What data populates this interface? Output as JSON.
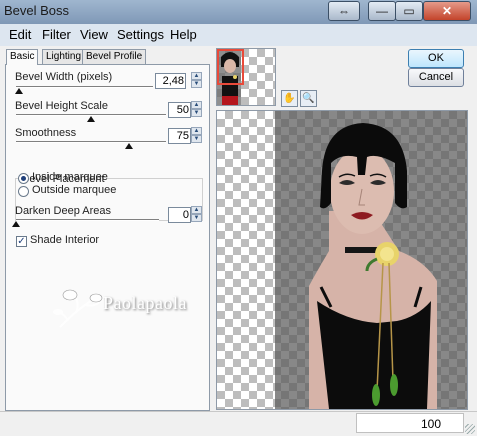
{
  "window": {
    "title": "Bevel Boss",
    "buttons": {
      "restore": "⇔",
      "minimize": "—",
      "maximize": "▭",
      "close": "✕"
    }
  },
  "menu": [
    "Edit",
    "Filter",
    "View",
    "Settings",
    "Help"
  ],
  "tabs": [
    "Basic",
    "Lighting",
    "Bevel Profile"
  ],
  "basic": {
    "bevel_width": {
      "label": "Bevel Width (pixels)",
      "value": "2,48",
      "level": 0.02
    },
    "bevel_height": {
      "label": "Bevel Height Scale",
      "value": "50",
      "level": 0.5
    },
    "smoothness": {
      "label": "Smoothness",
      "value": "75",
      "level": 0.75
    },
    "placement": {
      "legend": "Bevel Placement",
      "options": [
        "Inside marquee",
        "Outside marquee"
      ],
      "selected": "Inside marquee"
    },
    "darken": {
      "label": "Darken Deep Areas",
      "value": "0",
      "level": 0.0
    },
    "shade_interior": {
      "label": "Shade Interior",
      "checked": true
    }
  },
  "watermark": "Paolapaola",
  "actions": {
    "ok": "OK",
    "cancel": "Cancel"
  },
  "tools": {
    "pan": "pan-hand-icon",
    "zoom": "zoom-magnifier-icon"
  },
  "status": {
    "zoom": "100"
  },
  "colors": {
    "title_bar": "#8ea7c4",
    "close_button": "#c3442b",
    "ok_button": "#bee6fd",
    "preview_overlay": "#5a5a5a",
    "nav_box": "#e84a3a"
  }
}
